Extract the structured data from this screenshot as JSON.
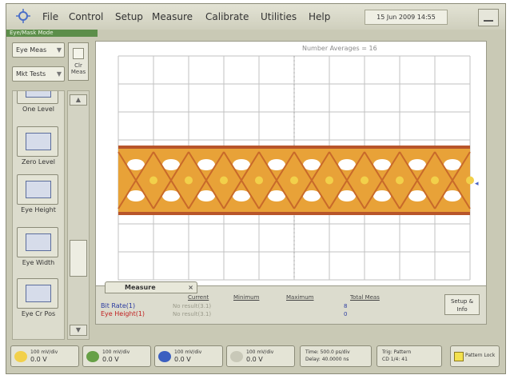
{
  "menu": {
    "items": [
      "File",
      "Control",
      "Setup",
      "Measure",
      "Calibrate",
      "Utilities",
      "Help"
    ],
    "date": "15 Jun 2009  14:55",
    "mode_label": "Eye/Mask Mode"
  },
  "left_panel": {
    "dropdown1": "Eye Meas",
    "dropdown2": "Mkt Tests",
    "clear_meas": "Clr Meas",
    "measurements": [
      "One Level",
      "Zero Level",
      "Eye Height",
      "Eye Width",
      "Eye Cr Pos"
    ]
  },
  "display": {
    "number_averages": "Number Averages =  16"
  },
  "measure_panel": {
    "tab_label": "Measure",
    "columns": [
      "Current",
      "Minimum",
      "Maximum",
      "Total Meas"
    ],
    "rows": [
      {
        "label": "Bit Rate(1)",
        "dim": "No result(3.1)",
        "value": "8"
      },
      {
        "label": "Eye Height(1)",
        "dim": "No result(3.1)",
        "value": "0"
      }
    ],
    "setup_button": "Setup & Info"
  },
  "bottom_bar": {
    "channels": [
      {
        "line1": "100 mV/div",
        "line2": "0.0 V",
        "color": "#f2d04a"
      },
      {
        "line1": "100 mV/div",
        "line2": "0.0 V",
        "color": "#66a046"
      },
      {
        "line1": "100 mV/div",
        "line2": "0.0 V",
        "color": "#3b5fc0"
      },
      {
        "line1": "100 mV/div",
        "line2": "0.0 V",
        "color": "#c8c8b8"
      }
    ],
    "time": {
      "line1": "Time: 500.0 ps/div",
      "line2": "Delay: 40.0000 ns"
    },
    "trigger": {
      "line1": "Trig: Pattern",
      "line2": "CD 1/4: 41"
    },
    "pattern_lock": "Pattern Lock"
  }
}
